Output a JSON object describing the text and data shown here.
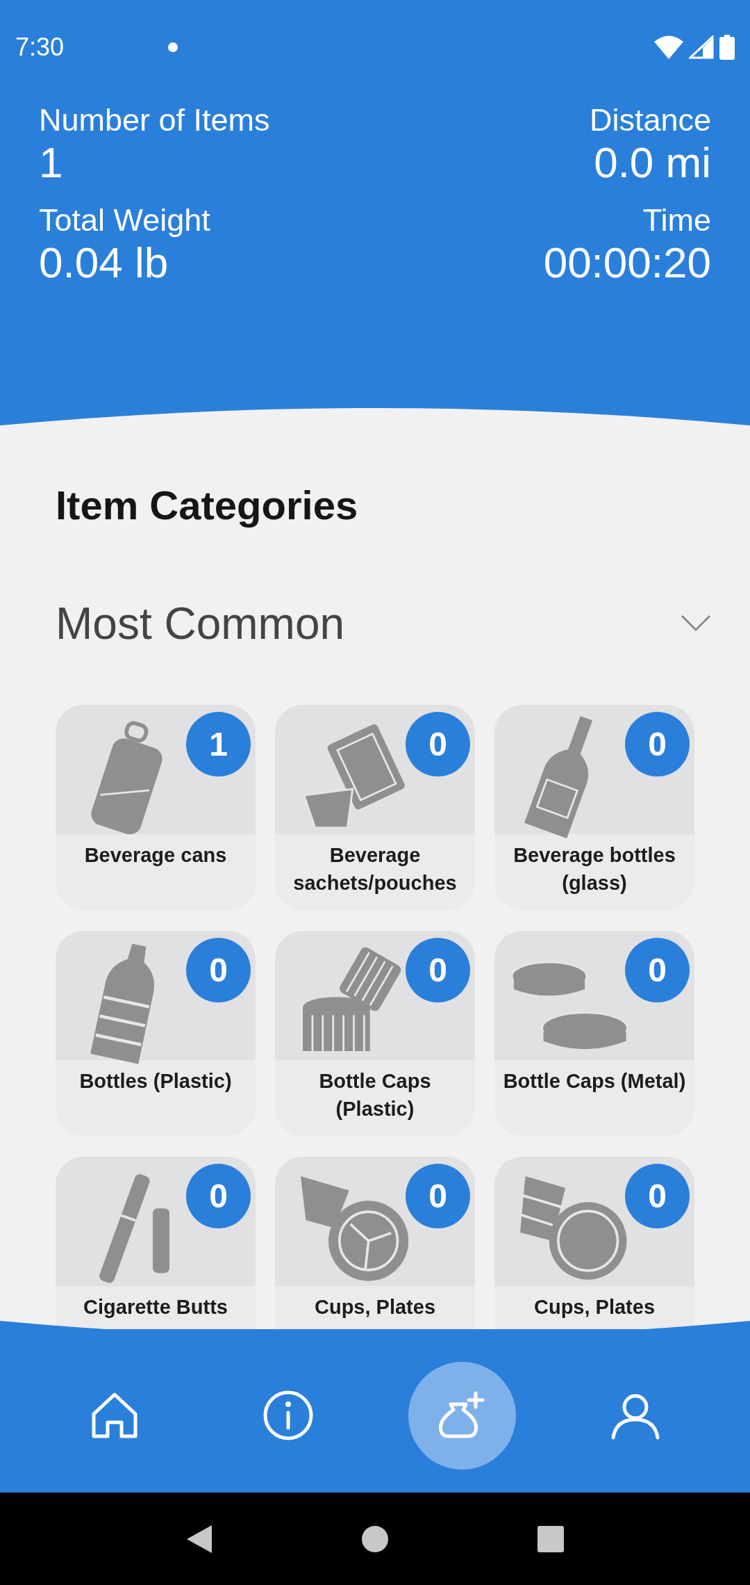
{
  "status_bar": {
    "time": "7:30"
  },
  "stats": [
    {
      "label": "Number of Items",
      "value": "1"
    },
    {
      "label": "Distance",
      "value": "0.0 mi"
    },
    {
      "label": "Total Weight",
      "value": "0.04 lb"
    },
    {
      "label": "Time",
      "value": "00:00:20"
    }
  ],
  "section_title": "Item Categories",
  "category_group": {
    "title": "Most Common",
    "expanded": true
  },
  "items": [
    {
      "label": "Beverage cans",
      "count": "1",
      "kind": "can"
    },
    {
      "label": "Beverage sachets/pouches",
      "count": "0",
      "kind": "pouch"
    },
    {
      "label": "Beverage bottles (glass)",
      "count": "0",
      "kind": "glass-bottle"
    },
    {
      "label": "Bottles (Plastic)",
      "count": "0",
      "kind": "plastic-bottle"
    },
    {
      "label": "Bottle Caps (Plastic)",
      "count": "0",
      "kind": "plastic-cap"
    },
    {
      "label": "Bottle Caps (Metal)",
      "count": "0",
      "kind": "metal-cap"
    },
    {
      "label": "Cigarette Butts",
      "count": "0",
      "kind": "cigarette"
    },
    {
      "label": "Cups, Plates",
      "count": "0",
      "kind": "paper-cup"
    },
    {
      "label": "Cups, Plates",
      "count": "0",
      "kind": "foam-cup"
    }
  ],
  "nav": [
    {
      "kind": "home"
    },
    {
      "kind": "info"
    },
    {
      "kind": "add-bag"
    },
    {
      "kind": "profile"
    }
  ]
}
